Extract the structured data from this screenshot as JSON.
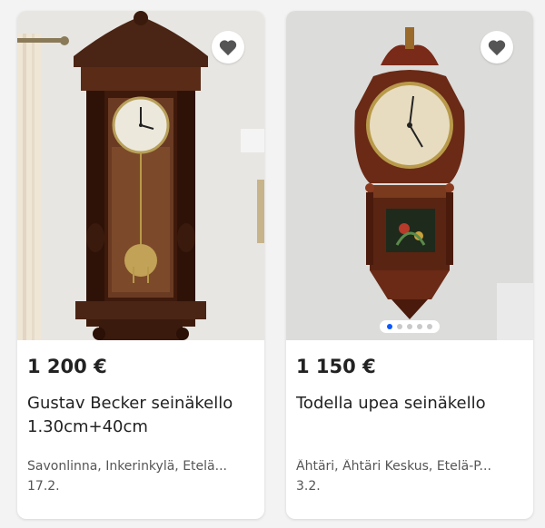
{
  "listings": [
    {
      "price": "1 200 €",
      "title": "Gustav Becker seinäkello 1.30cm+40cm",
      "location": "Savonlinna, Inkerinkylä, Etelä...",
      "date": "17.2.",
      "favorite_icon": "heart-icon"
    },
    {
      "price": "1 150 €",
      "title": "Todella upea seinäkello",
      "location": "Ähtäri, Ähtäri Keskus, Etelä-P...",
      "date": "3.2.",
      "favorite_icon": "heart-icon",
      "image_count": 5,
      "active_image": 1
    }
  ],
  "colors": {
    "accent": "#0b57ff",
    "heart": "#555555",
    "background": "#f3f3f3"
  }
}
